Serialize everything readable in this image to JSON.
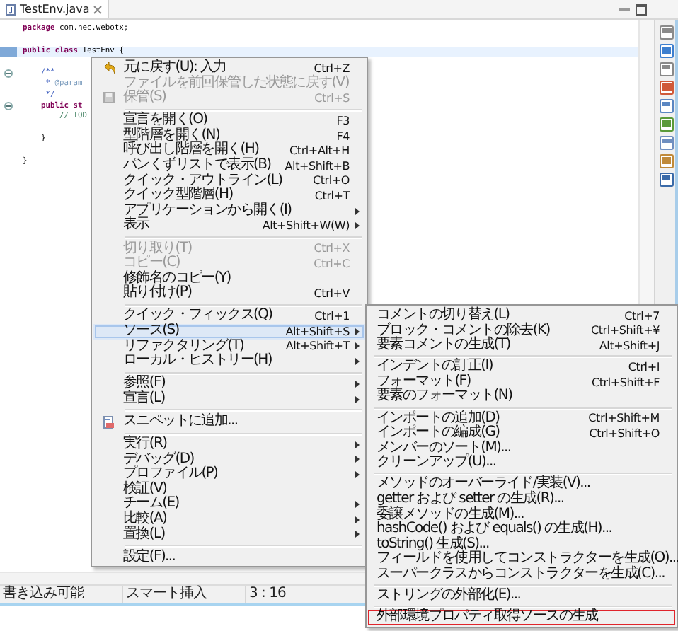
{
  "editor": {
    "tab": {
      "title": "TestEnv.java"
    },
    "lines": [
      {
        "current": false,
        "collapsible": false,
        "tokens": [
          {
            "text": "package",
            "kind": "keyword"
          },
          {
            "text": " com.nec.webotx;",
            "kind": "plain"
          }
        ]
      },
      {
        "current": false,
        "collapsible": false
      },
      {
        "current": true,
        "collapsible": false,
        "tokens": [
          {
            "text": "public class",
            "kind": "keyword"
          },
          {
            "text": " TestEnv {",
            "kind": "plain"
          }
        ]
      },
      {
        "current": false,
        "collapsible": false
      },
      {
        "current": false,
        "collapsible": true,
        "tokens": [
          {
            "text": "    /**",
            "kind": "javadoc"
          }
        ]
      },
      {
        "current": false,
        "collapsible": false,
        "tokens": [
          {
            "text": "     * ",
            "kind": "javadoc"
          },
          {
            "text": "@param",
            "kind": "tag"
          }
        ]
      },
      {
        "current": false,
        "collapsible": false,
        "tokens": [
          {
            "text": "     */",
            "kind": "javadoc"
          }
        ]
      },
      {
        "current": false,
        "collapsible": true,
        "tokens": [
          {
            "text": "    public st",
            "kind": "keyword"
          }
        ]
      },
      {
        "current": false,
        "collapsible": false,
        "tokens": [
          {
            "text": "        // TOD",
            "kind": "comment"
          }
        ]
      },
      {
        "current": false,
        "collapsible": false
      },
      {
        "current": false,
        "collapsible": false,
        "tokens": [
          {
            "text": "    }",
            "kind": "plain"
          }
        ]
      },
      {
        "current": false,
        "collapsible": false
      },
      {
        "current": false,
        "collapsible": false,
        "tokens": [
          {
            "text": "}",
            "kind": "plain"
          }
        ]
      }
    ]
  },
  "context_menu": [
    {
      "kind": "item",
      "label": "元に戻す(U): 入力",
      "shortcut": "Ctrl+Z",
      "disabled": false,
      "selected": false,
      "has_submenu": false
    },
    {
      "kind": "item",
      "label": "ファイルを前回保管した状態に戻す(V)",
      "disabled": true,
      "selected": false,
      "has_submenu": false
    },
    {
      "kind": "item",
      "label": "保管(S)",
      "shortcut": "Ctrl+S",
      "disabled": true,
      "selected": false,
      "has_submenu": false
    },
    {
      "kind": "separator"
    },
    {
      "kind": "item",
      "label": "宣言を開く(O)",
      "shortcut": "F3",
      "disabled": false,
      "selected": false,
      "has_submenu": false
    },
    {
      "kind": "item",
      "label": "型階層を開く(N)",
      "shortcut": "F4",
      "disabled": false,
      "selected": false,
      "has_submenu": false
    },
    {
      "kind": "item",
      "label": "呼び出し階層を開く(H)",
      "shortcut": "Ctrl+Alt+H",
      "disabled": false,
      "selected": false,
      "has_submenu": false
    },
    {
      "kind": "item",
      "label": "パンくずリストで表示(B)",
      "shortcut": "Alt+Shift+B",
      "disabled": false,
      "selected": false,
      "has_submenu": false
    },
    {
      "kind": "item",
      "label": "クイック・アウトライン(L)",
      "shortcut": "Ctrl+O",
      "disabled": false,
      "selected": false,
      "has_submenu": false
    },
    {
      "kind": "item",
      "label": "クイック型階層(H)",
      "shortcut": "Ctrl+T",
      "disabled": false,
      "selected": false,
      "has_submenu": false
    },
    {
      "kind": "item",
      "label": "アプリケーションから開く(I)",
      "disabled": false,
      "selected": false,
      "has_submenu": true
    },
    {
      "kind": "item",
      "label": "表示",
      "shortcut": "Alt+Shift+W(W)",
      "disabled": false,
      "selected": false,
      "has_submenu": true
    },
    {
      "kind": "separator"
    },
    {
      "kind": "item",
      "label": "切り取り(T)",
      "shortcut": "Ctrl+X",
      "disabled": true,
      "selected": false,
      "has_submenu": false
    },
    {
      "kind": "item",
      "label": "コピー(C)",
      "shortcut": "Ctrl+C",
      "disabled": true,
      "selected": false,
      "has_submenu": false
    },
    {
      "kind": "item",
      "label": "修飾名のコピー(Y)",
      "disabled": false,
      "selected": false,
      "has_submenu": false
    },
    {
      "kind": "item",
      "label": "貼り付け(P)",
      "shortcut": "Ctrl+V",
      "disabled": false,
      "selected": false,
      "has_submenu": false
    },
    {
      "kind": "separator"
    },
    {
      "kind": "item",
      "label": "クイック・フィックス(Q)",
      "shortcut": "Ctrl+1",
      "disabled": false,
      "selected": false,
      "has_submenu": false
    },
    {
      "kind": "item",
      "label": "ソース(S)",
      "shortcut": "Alt+Shift+S",
      "disabled": false,
      "selected": true,
      "has_submenu": true
    },
    {
      "kind": "item",
      "label": "リファクタリング(T)",
      "shortcut": "Alt+Shift+T",
      "disabled": false,
      "selected": false,
      "has_submenu": true
    },
    {
      "kind": "item",
      "label": "ローカル・ヒストリー(H)",
      "disabled": false,
      "selected": false,
      "has_submenu": true
    },
    {
      "kind": "separator"
    },
    {
      "kind": "item",
      "label": "参照(F)",
      "disabled": false,
      "selected": false,
      "has_submenu": true
    },
    {
      "kind": "item",
      "label": "宣言(L)",
      "disabled": false,
      "selected": false,
      "has_submenu": true
    },
    {
      "kind": "separator"
    },
    {
      "kind": "item",
      "label": "スニペットに追加...",
      "disabled": false,
      "selected": false,
      "has_submenu": false
    },
    {
      "kind": "separator"
    },
    {
      "kind": "item",
      "label": "実行(R)",
      "disabled": false,
      "selected": false,
      "has_submenu": true
    },
    {
      "kind": "item",
      "label": "デバッグ(D)",
      "disabled": false,
      "selected": false,
      "has_submenu": true
    },
    {
      "kind": "item",
      "label": "プロファイル(P)",
      "disabled": false,
      "selected": false,
      "has_submenu": true
    },
    {
      "kind": "item",
      "label": "検証(V)",
      "disabled": false,
      "selected": false,
      "has_submenu": false
    },
    {
      "kind": "item",
      "label": "チーム(E)",
      "disabled": false,
      "selected": false,
      "has_submenu": true
    },
    {
      "kind": "item",
      "label": "比較(A)",
      "disabled": false,
      "selected": false,
      "has_submenu": true
    },
    {
      "kind": "item",
      "label": "置換(L)",
      "disabled": false,
      "selected": false,
      "has_submenu": true
    },
    {
      "kind": "separator"
    },
    {
      "kind": "item",
      "label": "設定(F)...",
      "disabled": false,
      "selected": false,
      "has_submenu": false
    }
  ],
  "source_submenu": [
    {
      "kind": "item",
      "label": "コメントの切り替え(L)",
      "shortcut": "Ctrl+7",
      "highlighted": false
    },
    {
      "kind": "item",
      "label": "ブロック・コメントの除去(K)",
      "shortcut": "Ctrl+Shift+¥",
      "highlighted": false
    },
    {
      "kind": "item",
      "label": "要素コメントの生成(T)",
      "shortcut": "Alt+Shift+J",
      "highlighted": false
    },
    {
      "kind": "separator"
    },
    {
      "kind": "item",
      "label": "インデントの訂正(I)",
      "shortcut": "Ctrl+I",
      "highlighted": false
    },
    {
      "kind": "item",
      "label": "フォーマット(F)",
      "shortcut": "Ctrl+Shift+F",
      "highlighted": false
    },
    {
      "kind": "item",
      "label": "要素のフォーマット(N)",
      "highlighted": false
    },
    {
      "kind": "separator"
    },
    {
      "kind": "item",
      "label": "インポートの追加(D)",
      "shortcut": "Ctrl+Shift+M",
      "highlighted": false
    },
    {
      "kind": "item",
      "label": "インポートの編成(G)",
      "shortcut": "Ctrl+Shift+O",
      "highlighted": false
    },
    {
      "kind": "item",
      "label": "メンバーのソート(M)...",
      "highlighted": false
    },
    {
      "kind": "item",
      "label": "クリーンアップ(U)...",
      "highlighted": false
    },
    {
      "kind": "separator"
    },
    {
      "kind": "item",
      "label": "メソッドのオーバーライド/実装(V)...",
      "highlighted": false
    },
    {
      "kind": "item",
      "label": "getter および setter の生成(R)...",
      "highlighted": false
    },
    {
      "kind": "item",
      "label": "委譲メソッドの生成(M)...",
      "highlighted": false
    },
    {
      "kind": "item",
      "label": "hashCode() および equals() の生成(H)...",
      "highlighted": false
    },
    {
      "kind": "item",
      "label": "toString() 生成(S)...",
      "highlighted": false
    },
    {
      "kind": "item",
      "label": "フィールドを使用してコンストラクターを生成(O)...",
      "highlighted": false
    },
    {
      "kind": "item",
      "label": "スーパークラスからコンストラクターを生成(C)...",
      "highlighted": false
    },
    {
      "kind": "separator"
    },
    {
      "kind": "item",
      "label": "ストリングの外部化(E)...",
      "highlighted": false
    },
    {
      "kind": "separator"
    },
    {
      "kind": "item",
      "label": "外部環境プロパティ取得ソースの生成",
      "highlighted": true
    }
  ],
  "status_bar": [
    "書き込み可能",
    "スマート挿入",
    "3 : 16"
  ]
}
